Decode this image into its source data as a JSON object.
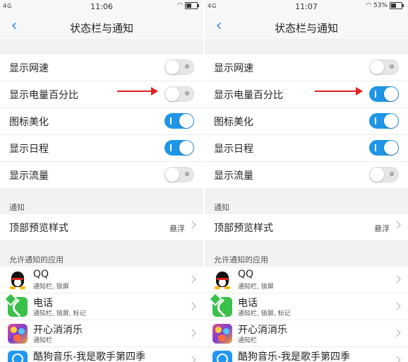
{
  "colors": {
    "accent": "#1e95e6",
    "arrow": "#e02020",
    "toggle_off": "#e6e6e6"
  },
  "screens": [
    {
      "statusbar": {
        "network": "4G",
        "time": "11:06",
        "battery_percent": ""
      },
      "header": {
        "back_icon": "chevron-left-icon",
        "title": "状态栏与通知"
      },
      "settings": [
        {
          "label": "显示网速",
          "on": false
        },
        {
          "label": "显示电量百分比",
          "on": false
        },
        {
          "label": "图标美化",
          "on": true
        },
        {
          "label": "显示日程",
          "on": true
        },
        {
          "label": "显示流量",
          "on": false
        }
      ],
      "notification_section": {
        "title": "通知",
        "item_label": "顶部预览样式",
        "item_value": "悬浮"
      },
      "apps_section": {
        "title": "允许通知的应用",
        "apps": [
          {
            "name": "QQ",
            "sub": "通知栏, 锁屏",
            "icon": "qq-icon"
          },
          {
            "name": "电话",
            "sub": "通知栏, 锁屏, 标记",
            "icon": "phone-icon"
          },
          {
            "name": "开心消消乐",
            "sub": "通知栏",
            "icon": "game-icon"
          },
          {
            "name": "酷狗音乐-我是歌手第四季",
            "sub": "",
            "icon": "kugou-icon"
          }
        ]
      }
    },
    {
      "statusbar": {
        "network": "4G",
        "time": "11:07",
        "battery_percent": "53%"
      },
      "header": {
        "back_icon": "chevron-left-icon",
        "title": "状态栏与通知"
      },
      "settings": [
        {
          "label": "显示网速",
          "on": false
        },
        {
          "label": "显示电量百分比",
          "on": true
        },
        {
          "label": "图标美化",
          "on": true
        },
        {
          "label": "显示日程",
          "on": true
        },
        {
          "label": "显示流量",
          "on": false
        }
      ],
      "notification_section": {
        "title": "通知",
        "item_label": "顶部预览样式",
        "item_value": "悬浮"
      },
      "apps_section": {
        "title": "允许通知的应用",
        "apps": [
          {
            "name": "QQ",
            "sub": "通知栏, 锁屏",
            "icon": "qq-icon"
          },
          {
            "name": "电话",
            "sub": "通知栏, 锁屏, 标记",
            "icon": "phone-icon"
          },
          {
            "name": "开心消消乐",
            "sub": "通知栏",
            "icon": "game-icon"
          },
          {
            "name": "酷狗音乐-我是歌手第四季",
            "sub": "",
            "icon": "kugou-icon"
          }
        ]
      }
    }
  ]
}
